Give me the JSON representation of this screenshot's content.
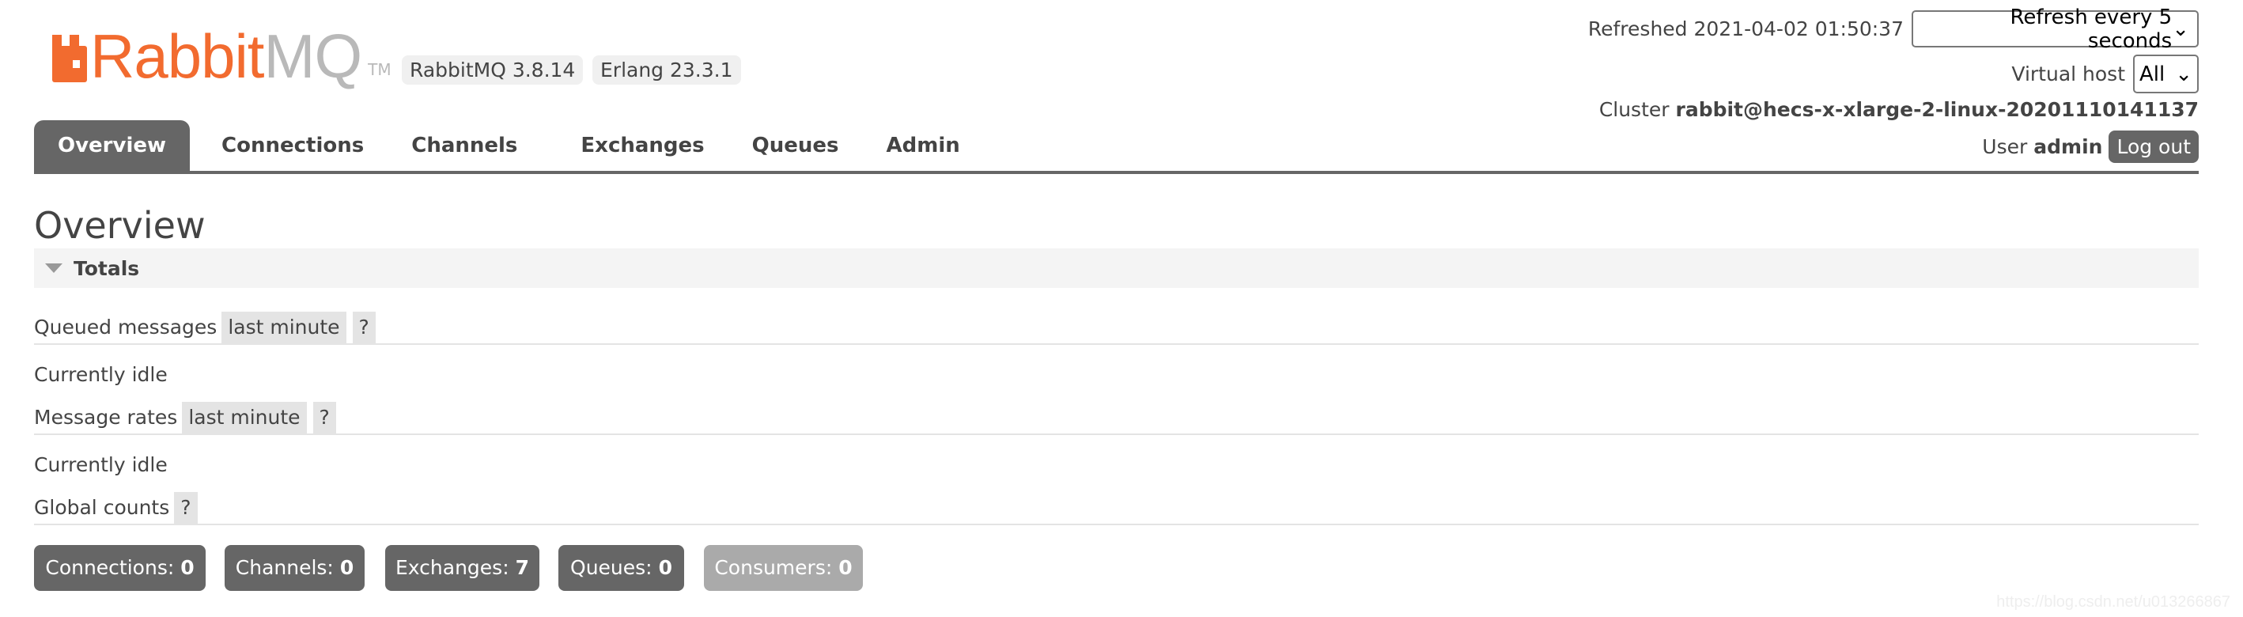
{
  "logo": {
    "part1": "Rabbit",
    "part2": "MQ",
    "tm": "TM"
  },
  "versions": {
    "rabbitmq": "RabbitMQ 3.8.14",
    "erlang": "Erlang 23.3.1"
  },
  "nav": {
    "tabs": [
      {
        "label": "Overview",
        "active": true
      },
      {
        "label": "Connections"
      },
      {
        "label": "Channels"
      },
      {
        "label": "Exchanges"
      },
      {
        "label": "Queues"
      },
      {
        "label": "Admin"
      }
    ]
  },
  "header": {
    "refreshed": "Refreshed 2021-04-02 01:50:37",
    "refresh_select": "Refresh every 5 seconds",
    "vhost_label": "Virtual host",
    "vhost_select": "All",
    "cluster_label": "Cluster",
    "cluster_name": "rabbit@hecs-x-xlarge-2-linux-20201110141137",
    "user_label": "User",
    "user_name": "admin",
    "logout": "Log out"
  },
  "page": {
    "title": "Overview"
  },
  "totals": {
    "title": "Totals",
    "queued_label": "Queued messages",
    "queued_range": "last minute",
    "help": "?",
    "queued_status": "Currently idle",
    "rates_label": "Message rates",
    "rates_range": "last minute",
    "rates_status": "Currently idle",
    "global_label": "Global counts"
  },
  "counts": [
    {
      "label": "Connections:",
      "value": "0"
    },
    {
      "label": "Channels:",
      "value": "0"
    },
    {
      "label": "Exchanges:",
      "value": "7"
    },
    {
      "label": "Queues:",
      "value": "0"
    },
    {
      "label": "Consumers:",
      "value": "0"
    }
  ],
  "watermark": "https://blog.csdn.net/u013266867",
  "colors": {
    "brand": "#f26b2f",
    "tab_active": "#666666",
    "count_dim": "#aaaaaa"
  }
}
